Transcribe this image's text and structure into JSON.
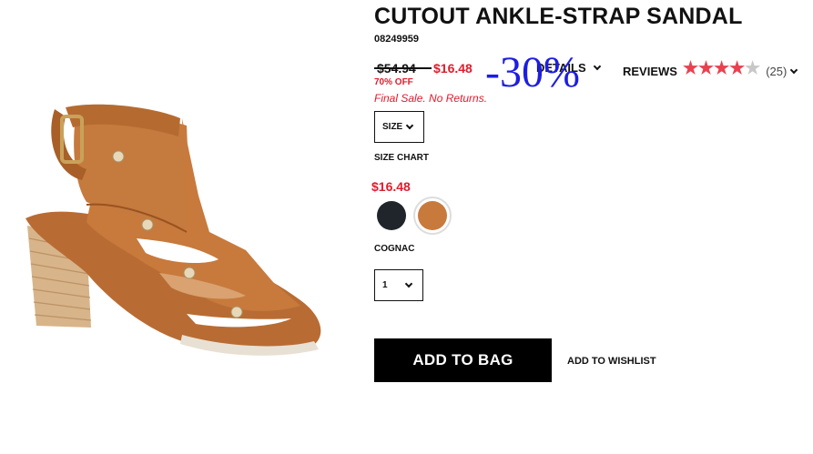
{
  "product": {
    "title": "CUTOUT ANKLE-STRAP SANDAL",
    "sku": "08249959",
    "price_original": "$54.94",
    "price_sale": "$16.48",
    "discount_label": "70% OFF",
    "final_sale_note": "Final Sale. No Returns.",
    "overlay_discount": "-30%"
  },
  "tabs": {
    "details_label": "DETAILS",
    "reviews_label": "REVIEWS",
    "rating": 4,
    "rating_max": 5,
    "review_count": "(25)"
  },
  "options": {
    "size_label": "SIZE",
    "size_chart_label": "SIZE CHART",
    "swatch_price": "$16.48",
    "swatches": [
      {
        "name": "black",
        "color": "#20242b"
      },
      {
        "name": "cognac",
        "color": "#c77a3c",
        "selected": true
      }
    ],
    "selected_color_label": "COGNAC",
    "quantity_value": "1"
  },
  "actions": {
    "add_to_bag_label": "ADD TO BAG",
    "wishlist_label": "ADD TO WISHLIST"
  },
  "colors": {
    "sale_red": "#e21b2d",
    "star_red": "#e8424f",
    "overlay_blue": "#1e1ee0",
    "leather_cognac": "#c77a3c"
  }
}
